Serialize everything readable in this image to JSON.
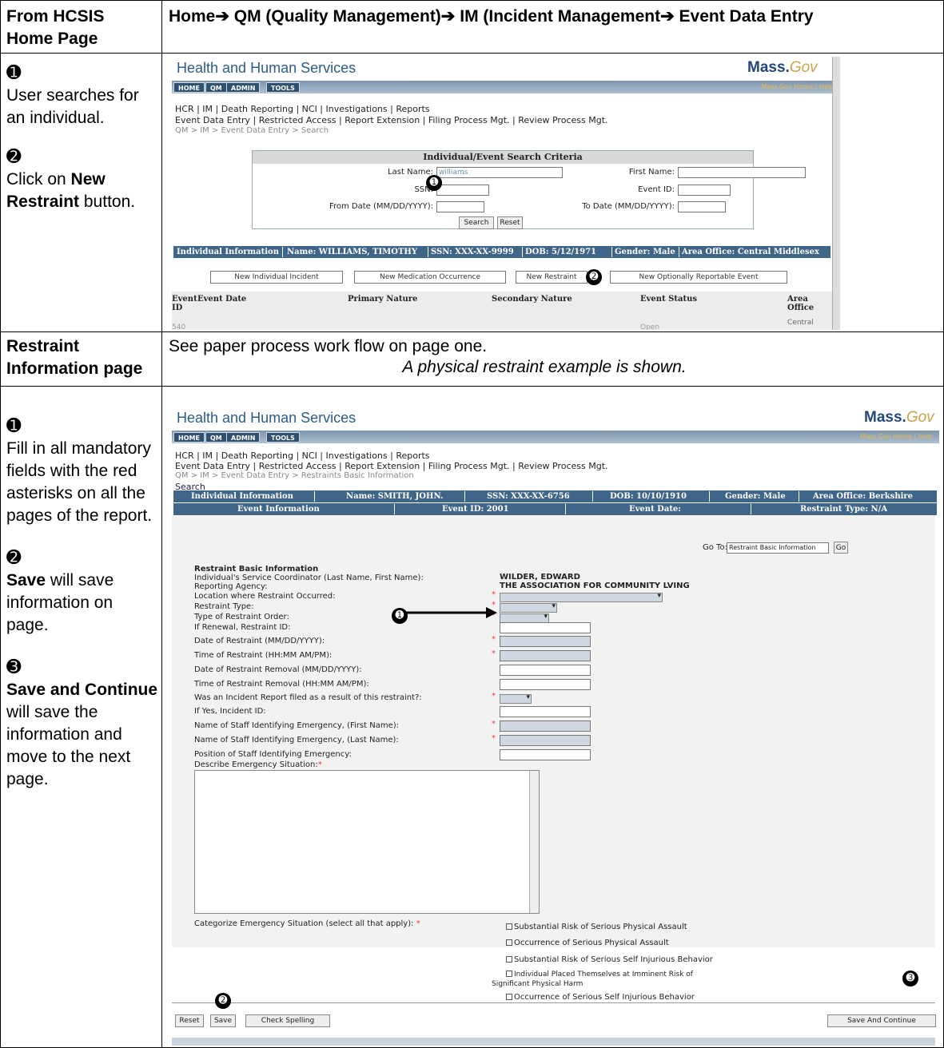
{
  "header": {
    "left_line1": "From HCSIS",
    "left_line2": "Home Page",
    "right": "Home➔ QM (Quality Management)➔ IM (Incident Management➔ Event Data Entry"
  },
  "step1": {
    "n1": "➊",
    "n1_text": "User searches for an individual.",
    "n2": "➋",
    "n2_pre": "Click on",
    "n2_bold": "New Restraint",
    "n2_post": "button."
  },
  "restraint_row": {
    "left": "Restraint Information page",
    "line1": "See paper process work flow on page one.",
    "line2": "A physical restraint example is shown."
  },
  "step2": {
    "n1": "➊",
    "n1_text": "Fill in all mandatory fields with the red asterisks on all the pages of the report.",
    "n2": "➋",
    "n2_bold": "Save",
    "n2_post": "will save information on page.",
    "n3": "➌",
    "n3_bold": "Save and Continue",
    "n3_post": "will save the information and move to the next page."
  },
  "shot1": {
    "title": "Health and Human Services",
    "logo": "Mass.",
    "logo_gov": "Gov",
    "tabs": [
      "HOME",
      "QM",
      "ADMIN",
      "TOOLS"
    ],
    "masslinks": "Mass.Gov Home | Help",
    "menu1": "HCR | IM | Death Reporting | NCI | Investigations | Reports",
    "menu2": "Event Data Entry | Restricted Access | Report Extension | Filing Process Mgt. | Review Process Mgt.",
    "breadcrumb": "QM > IM > Event Data Entry > Search",
    "form_title": "Individual/Event Search Criteria",
    "last_name_label": "Last Name:",
    "last_name_value": "williams",
    "first_name_label": "First Name:",
    "ssn_label": "SSN:",
    "event_id_label": "Event ID:",
    "from_label": "From Date (MM/DD/YYYY):",
    "to_label": "To Date (MM/DD/YYYY):",
    "search": "Search",
    "reset": "Reset",
    "info_bar": [
      "Individual Information",
      "Name: WILLIAMS, TIMOTHY",
      "SSN: XXX-XX-9999",
      "DOB: 5/12/1971",
      "Gender: Male",
      "Area Office: Central Middlesex"
    ],
    "buttons": [
      "New Individual Incident",
      "New Medication Occurrence",
      "New Restraint",
      "New Optionally Reportable Event"
    ],
    "cols": [
      "Event ID",
      "Event Date",
      "Primary Nature",
      "Secondary Nature",
      "Event Status",
      "Area Office"
    ],
    "row": {
      "id": "540",
      "status": "Open",
      "office": "Central"
    }
  },
  "shot2": {
    "title": "Health and Human Services",
    "logo": "Mass.",
    "logo_gov": "Gov",
    "tabs": [
      "HOME",
      "QM",
      "ADMIN",
      "TOOLS"
    ],
    "masslinks": "Mass.Gov Home | Help",
    "menu1": "HCR | IM | Death Reporting | NCI | Investigations | Reports",
    "menu2": "Event Data Entry | Restricted Access | Report Extension | Filing Process Mgt. | Review Process Mgt.",
    "breadcrumb": "QM > IM > Event Data Entry > Restraints Basic Information",
    "search_link": "Search",
    "bar1": [
      "Individual Information",
      "Name: SMITH, JOHN.",
      "SSN: XXX-XX-6756",
      "DOB: 10/10/1910",
      "Gender: Male",
      "Area Office: Berkshire"
    ],
    "bar2": [
      "Event Information",
      "Event ID: 2001",
      "Event Date:",
      "Restraint Type: N/A"
    ],
    "goto_label": "Go To:",
    "goto_value": "Restraint Basic Information",
    "go": "Go",
    "section": "Restraint Basic Information",
    "fields": [
      {
        "label": "Individual's Service Coordinator (Last Name, First Name):",
        "value": "WILDER, EDWARD"
      },
      {
        "label": "Reporting Agency:",
        "value": "THE ASSOCIATION FOR COMMUNITY LVING"
      },
      {
        "label": "Location where Restraint Occurred:"
      },
      {
        "label": "Restraint Type:"
      },
      {
        "label": "Type of Restraint Order:"
      },
      {
        "label": "If Renewal, Restraint ID:"
      },
      {
        "label": "Date of Restraint (MM/DD/YYYY):"
      },
      {
        "label": "Time of Restraint (HH:MM AM/PM):"
      },
      {
        "label": "Date of Restraint Removal (MM/DD/YYYY):"
      },
      {
        "label": "Time of Restraint Removal (HH:MM AM/PM):"
      },
      {
        "label": "Was an Incident Report filed as a result of this restraint?:"
      },
      {
        "label": "If Yes, Incident ID:"
      },
      {
        "label": "Name of Staff Identifying Emergency, (First Name):"
      },
      {
        "label": "Name of Staff Identifying Emergency, (Last Name):"
      },
      {
        "label": "Position of Staff Identifying Emergency:"
      }
    ],
    "describe_label": "Describe Emergency Situation:",
    "categorize_label": "Categorize Emergency Situation (select all that apply):",
    "checkboxes": [
      "Substantial Risk of Serious Physical Assault",
      "Occurrence of Serious Physical Assault",
      "Substantial Risk of Serious Self Injurious Behavior",
      "Individual Placed Themselves at Imminent Risk of",
      "Significant Physical Harm",
      "Occurrence of Serious Self Injurious Behavior"
    ],
    "reset": "Reset",
    "save": "Save",
    "spell": "Check Spelling",
    "save_continue": "Save And Continue",
    "star": "*"
  },
  "markers": {
    "m1": "➊",
    "m2": "➋",
    "m3": "➌"
  }
}
